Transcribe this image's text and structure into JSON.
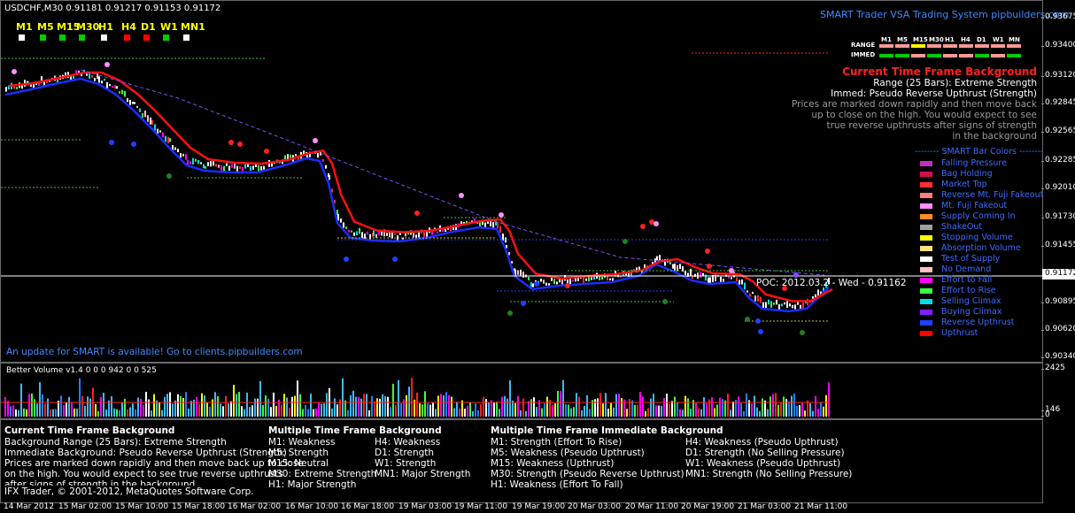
{
  "chart": {
    "symbol_info": "USDCHF,M30  0.91181 0.91217 0.91153 0.91172",
    "brand": "SMART Trader VSA Trading System pipbuilders.com",
    "update_notice": "An update for SMART is available! Go to clients.pipbuilders.com",
    "poc_label": "POC: 2012.03.2",
    "poc_suffix": "- Wed - 0.91162",
    "current_price": "0.91172",
    "price_ticks": [
      "0.93675",
      "0.93400",
      "0.93120",
      "0.92845",
      "0.92565",
      "0.92285",
      "0.92010",
      "0.91730",
      "0.91455",
      "0.90895",
      "0.90620",
      "0.90340"
    ],
    "volume_ticks": [
      "2425",
      "146",
      "0"
    ],
    "time_ticks": [
      "14 Mar 2012",
      "15 Mar 02:00",
      "15 Mar 10:00",
      "15 Mar 18:00",
      "16 Mar 02:00",
      "16 Mar 10:00",
      "16 Mar 18:00",
      "19 Mar 03:00",
      "19 Mar 11:00",
      "19 Mar 19:00",
      "20 Mar 03:00",
      "20 Mar 11:00",
      "20 Mar 19:00",
      "21 Mar 03:00",
      "21 Mar 11:00"
    ]
  },
  "timeframes": [
    {
      "label": "M1",
      "color": "#ffffff"
    },
    {
      "label": "M5",
      "color": "#00cc00"
    },
    {
      "label": "M15",
      "color": "#00cc00"
    },
    {
      "label": "M30",
      "color": "#00cc00"
    },
    {
      "label": "H1",
      "color": "#ffffff"
    },
    {
      "label": "H4",
      "color": "#ff0000"
    },
    {
      "label": "D1",
      "color": "#ff0000"
    },
    {
      "label": "W1",
      "color": "#00cc00"
    },
    {
      "label": "MN1",
      "color": "#ffffff"
    }
  ],
  "mtf_table": {
    "headers": [
      "M1",
      "M5",
      "M15",
      "M30",
      "H1",
      "H4",
      "D1",
      "W1",
      "MN"
    ],
    "range_label": "RANGE",
    "immed_label": "IMMED",
    "range_colors": [
      "#ff9999",
      "#ff9999",
      "#ffff00",
      "#ff9999",
      "#ff9999",
      "#ff9999",
      "#ff9999",
      "#ff9999",
      "#ff9999"
    ],
    "immed_colors": [
      "#00cc00",
      "#00cc00",
      "#ff9999",
      "#00cc00",
      "#ff9999",
      "#ff9999",
      "#00cc00",
      "#ff9999",
      "#00cc00"
    ]
  },
  "background": {
    "title": "Current Time Frame Background",
    "range": "Range (25 Bars): Extreme Strength",
    "immed": "Immed: Pseudo Reverse Upthrust (Strength)",
    "desc_lines": [
      "Prices are marked down rapidly and then move back",
      "up to close on the high. You would expect to see",
      "true reverse upthrusts after signs of strength",
      "in the background"
    ]
  },
  "legend": {
    "title": "SMART Bar Colors",
    "items": [
      {
        "label": "Falling Pressure",
        "color": "#c030c0"
      },
      {
        "label": "Bag Holding",
        "color": "#d01050"
      },
      {
        "label": "Market Top",
        "color": "#ff3030"
      },
      {
        "label": "Reverse Mt. Fuji Fakeout",
        "color": "#ff8080"
      },
      {
        "label": "Mt. Fuji Fakeout",
        "color": "#ff90ff"
      },
      {
        "label": "Supply Coming In",
        "color": "#ff9020"
      },
      {
        "label": "ShakeOut",
        "color": "#a0a0a0"
      },
      {
        "label": "Stopping Volume",
        "color": "#ffff00"
      },
      {
        "label": "Absorption Volume",
        "color": "#ffe080"
      },
      {
        "label": "Test of Supply",
        "color": "#ffffff"
      },
      {
        "label": "No Demand",
        "color": "#ffc0c0"
      },
      {
        "label": "Effort to Fall",
        "color": "#ff00ff"
      },
      {
        "label": "Effort to Rise",
        "color": "#40ff40"
      },
      {
        "label": "Selling Climax",
        "color": "#00e0e0"
      },
      {
        "label": "Buying Climax",
        "color": "#8020ff"
      },
      {
        "label": "Reverse Upthrust",
        "color": "#2040ff"
      },
      {
        "label": "Upthrust",
        "color": "#ff0000"
      }
    ]
  },
  "volume": {
    "title": "Better Volume v1.4 0 0 0 942 0 0 525"
  },
  "info": {
    "col1": {
      "title": "Current Time Frame Background",
      "lines": [
        "Background Range (25 Bars): Extreme Strength",
        "Immediate Background: Pseudo Reverse Upthrust (Strength)"
      ],
      "gray_lines": [
        "Prices are marked down rapidly and then move back up to close",
        "on the high. You would expect to see true reverse upthrusts",
        "after signs of strength in the background"
      ],
      "copyright": "IFX Trader, © 2001-2012, MetaQuotes Software Corp."
    },
    "col2": {
      "title": "Multiple Time Frame Background",
      "rows": [
        [
          "M1:    Weakness",
          "H4:  Weakness"
        ],
        [
          "M5:    Strength",
          "D1:   Strength"
        ],
        [
          "M15:  Neutral",
          "W1:    Strength"
        ],
        [
          "M30:  Extreme Strength",
          "MN1: Major Strength"
        ],
        [
          "H1:    Major Strength",
          ""
        ]
      ]
    },
    "col3": {
      "title": "Multiple Time Frame Immediate Background",
      "rows": [
        [
          "M1:    Strength (Effort To Rise)",
          "H4:  Weakness (Pseudo Upthrust)"
        ],
        [
          "M5:    Weakness (Pseudo Upthrust)",
          "D1:   Strength (No Selling Pressure)"
        ],
        [
          "M15:  Weakness (Upthrust)",
          "W1:    Weakness (Pseudo Upthrust)"
        ],
        [
          "M30:  Strength (Pseudo Reverse Upthrust)",
          "MN1: Strength (No Selling Pressure)"
        ],
        [
          "H1:    Weakness (Effort To Fall)",
          ""
        ]
      ]
    }
  }
}
